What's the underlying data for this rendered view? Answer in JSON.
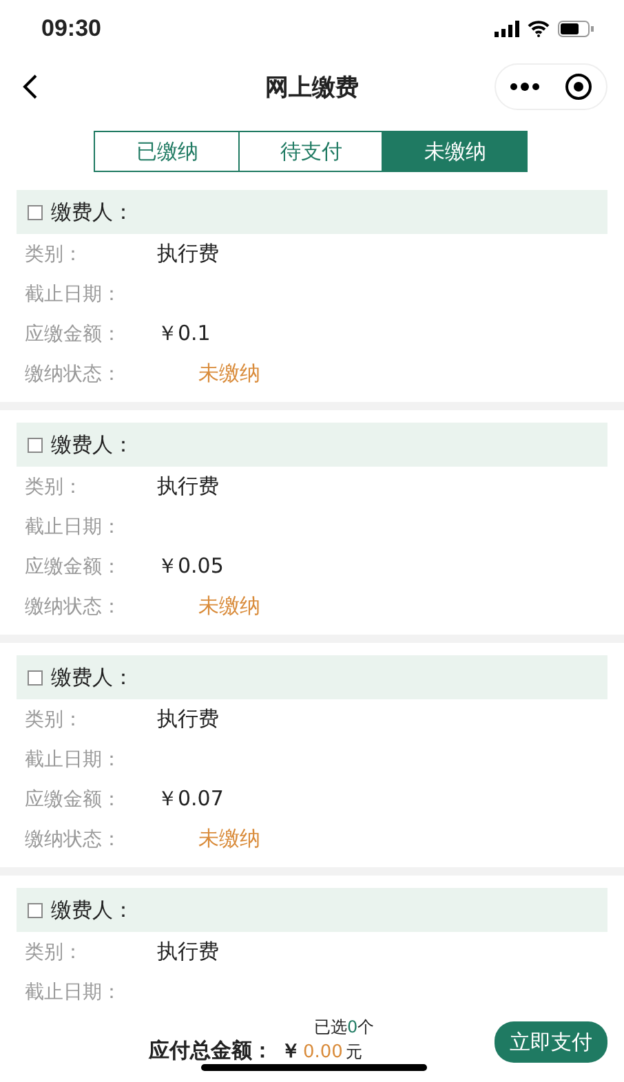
{
  "status_bar": {
    "time": "09:30"
  },
  "nav": {
    "title": "网上缴费"
  },
  "tabs": [
    {
      "label": "已缴纳",
      "selected": false
    },
    {
      "label": "待支付",
      "selected": false
    },
    {
      "label": "未缴纳",
      "selected": true
    }
  ],
  "cards": [
    {
      "checked": false,
      "payer_label": "缴费人：",
      "fields": [
        {
          "kind": "plain",
          "label": "类别：",
          "value": "执行费"
        },
        {
          "kind": "plain",
          "label": "截止日期："
        },
        {
          "kind": "plain",
          "label": "应缴金额：",
          "value": "￥0.1"
        },
        {
          "kind": "status",
          "label": "缴纳状态：",
          "value": "未缴纳"
        }
      ]
    },
    {
      "checked": false,
      "payer_label": "缴费人：",
      "fields": [
        {
          "kind": "plain",
          "label": "类别：",
          "value": "执行费"
        },
        {
          "kind": "plain",
          "label": "截止日期："
        },
        {
          "kind": "plain",
          "label": "应缴金额：",
          "value": "￥0.05"
        },
        {
          "kind": "status",
          "label": "缴纳状态：",
          "value": "未缴纳"
        }
      ]
    },
    {
      "checked": false,
      "payer_label": "缴费人：",
      "fields": [
        {
          "kind": "plain",
          "label": "类别：",
          "value": "执行费"
        },
        {
          "kind": "plain",
          "label": "截止日期："
        },
        {
          "kind": "plain",
          "label": "应缴金额：",
          "value": "￥0.07"
        },
        {
          "kind": "status",
          "label": "缴纳状态：",
          "value": "未缴纳"
        }
      ]
    },
    {
      "checked": false,
      "payer_label": "缴费人：",
      "fields": [
        {
          "kind": "plain",
          "label": "类别：",
          "value": "执行费"
        },
        {
          "kind": "plain",
          "label": "截止日期："
        }
      ]
    }
  ],
  "footer": {
    "selected_prefix": "已选",
    "selected_count": "0",
    "selected_suffix": "个",
    "total_label": "应付总金额：",
    "currency": "￥",
    "total_amount": "0.00",
    "unit": "元",
    "pay_button": "立即支付"
  }
}
